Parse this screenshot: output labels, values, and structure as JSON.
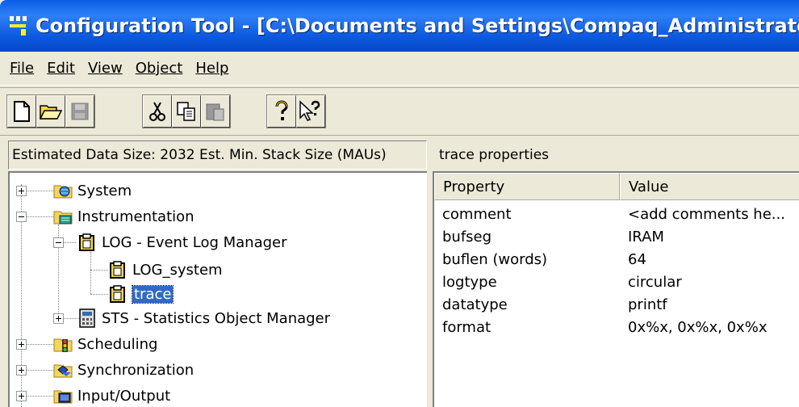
{
  "window": {
    "title": "Configuration Tool - [C:\\Documents and Settings\\Compaq_Administrator\\My"
  },
  "menu": [
    {
      "label": "File"
    },
    {
      "label": "Edit"
    },
    {
      "label": "View"
    },
    {
      "label": "Object"
    },
    {
      "label": "Help"
    }
  ],
  "toolbar": {
    "buttons": [
      "new-document-icon",
      "open-folder-icon",
      "save-icon",
      "cut-icon",
      "copy-icon",
      "paste-icon",
      "help-icon",
      "context-help-icon"
    ]
  },
  "left_panel": {
    "header": "Estimated Data Size: 2032   Est. Min. Stack Size (MAUs)"
  },
  "tree": {
    "system": "System",
    "instrumentation": "Instrumentation",
    "log_manager": "LOG - Event Log Manager",
    "log_system": "LOG_system",
    "trace": "trace",
    "sts_manager": "STS - Statistics Object Manager",
    "scheduling": "Scheduling",
    "synchronization": "Synchronization",
    "input_output": "Input/Output"
  },
  "right_panel": {
    "header": "trace properties",
    "columns": {
      "property": "Property",
      "value": "Value"
    },
    "rows": [
      {
        "property": "comment",
        "value": "<add comments he..."
      },
      {
        "property": "bufseg",
        "value": "IRAM"
      },
      {
        "property": "buflen (words)",
        "value": "64"
      },
      {
        "property": "logtype",
        "value": "circular"
      },
      {
        "property": "datatype",
        "value": "printf"
      },
      {
        "property": "format",
        "value": "0x%x, 0x%x, 0x%x"
      }
    ]
  },
  "colors": {
    "titlebar": "#0a5ce8",
    "selection": "#316ac5",
    "chrome": "#ece9d8"
  }
}
